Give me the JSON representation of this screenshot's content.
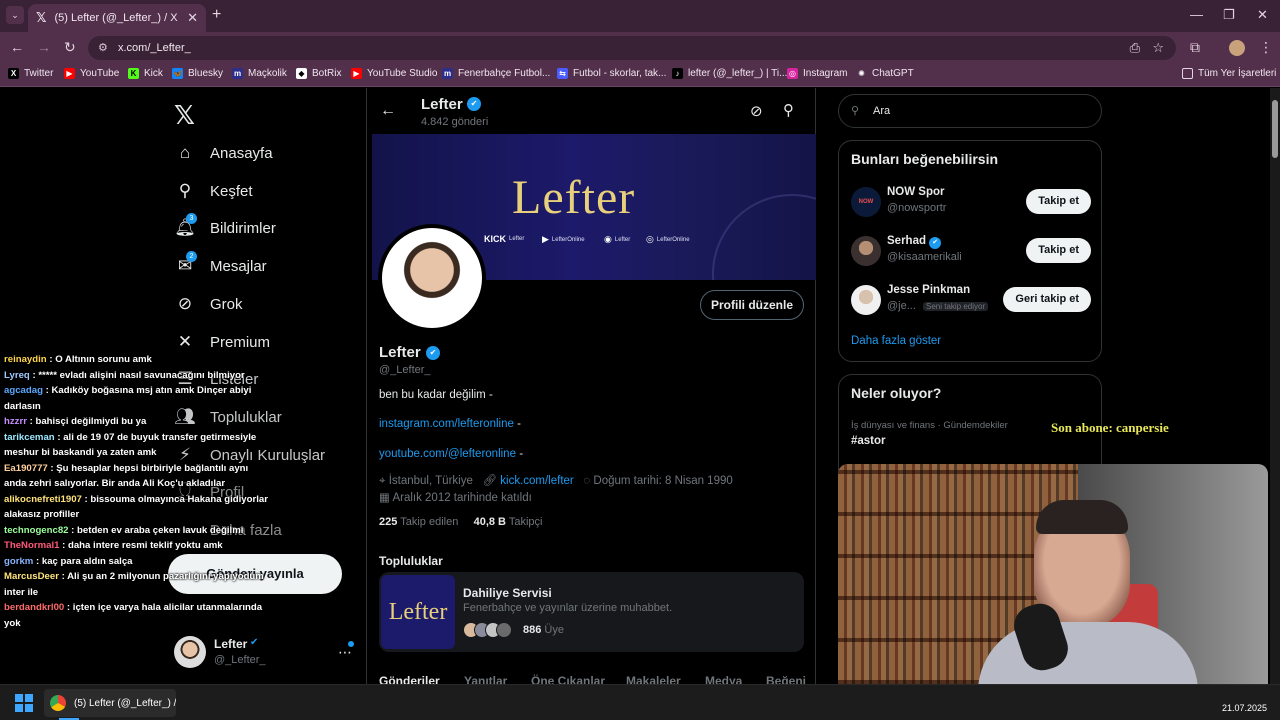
{
  "browser": {
    "tab_title": "(5) Lefter (@_Lefter_) / X",
    "url": "x.com/_Lefter_",
    "bookmarks": [
      "Twitter",
      "YouTube",
      "Kick",
      "Bluesky",
      "Maçkolik",
      "BotRix",
      "YouTube Studio",
      "Fenerbahçe Futbol...",
      "Futbol - skorlar, tak...",
      "lefter (@_lefter_) | Ti...",
      "Instagram",
      "ChatGPT"
    ],
    "all_bookmarks": "Tüm Yer İşaretleri"
  },
  "sidebar": {
    "items": [
      {
        "label": "Anasayfa",
        "icon": "home-icon"
      },
      {
        "label": "Keşfet",
        "icon": "search-icon"
      },
      {
        "label": "Bildirimler",
        "icon": "bell-icon",
        "badge": "3"
      },
      {
        "label": "Mesajlar",
        "icon": "mail-icon",
        "badge": "2"
      },
      {
        "label": "Grok",
        "icon": "grok-icon"
      },
      {
        "label": "Premium",
        "icon": "x-icon"
      },
      {
        "label": "Listeler",
        "icon": "list-icon"
      },
      {
        "label": "Topluluklar",
        "icon": "people-icon"
      },
      {
        "label": "Onaylı Kuruluşlar",
        "icon": "lightning-icon"
      },
      {
        "label": "Profil",
        "icon": "person-icon"
      },
      {
        "label": "Daha fazla",
        "icon": "more-icon"
      }
    ],
    "post_label": "Gönderi yayınla",
    "account_name": "Lefter",
    "account_handle": "@_Lefter_"
  },
  "chat": [
    {
      "user": "reinaydin",
      "color": "#ffd54a",
      "text": "O Altının sorunu amk"
    },
    {
      "user": "Lyreq",
      "color": "#9ecbff",
      "text": "***** evladı alişini nasıl savunacağını bilmiyor"
    },
    {
      "user": "agcadag",
      "color": "#5aa9ff",
      "text": "Kadıköy boğasına msj atın amk Dinçer abiyi darlasın"
    },
    {
      "user": "hzzrr",
      "color": "#c58cff",
      "text": "bahisçi değilmiydi bu ya"
    },
    {
      "user": "tarikceman",
      "color": "#9ee8ff",
      "text": "ali de 19 07 de buyuk transfer getirmesiyle meshur bi baskandi ya zaten amk"
    },
    {
      "user": "Ea190777",
      "color": "#ffd0a0",
      "text": "Şu hesaplar hepsi birbiriyle bağlantılı aynı anda zehri salıyorlar. Bir anda Ali Koç'u akladılar"
    },
    {
      "user": "alikocnefreti1907",
      "color": "#ffe27a",
      "text": "bissouma olmayınca Hakana gidiyorlar alakasız profiller"
    },
    {
      "user": "technogenc82",
      "color": "#9cff9c",
      "text": "betden ev araba çeken lavuk değilmi"
    },
    {
      "user": "TheNormal1",
      "color": "#ff5a7a",
      "text": "daha intere resmi teklif yoktu amk"
    },
    {
      "user": "gorkm",
      "color": "#8ab4ff",
      "text": "kaç para aldın salça"
    },
    {
      "user": "MarcusDeer",
      "color": "#ffe47a",
      "text": "Ali şu an 2 milyonun pazarlığını yapıyodum inter ile"
    },
    {
      "user": "berdandkrl00",
      "color": "#ff6b6b",
      "text": "içten içe varya hala alicilar utanmalarında yok"
    }
  ],
  "profile": {
    "name": "Lefter",
    "post_count": "4.842 gönderi",
    "handle": "@_Lefter_",
    "bio": "ben bu kadar değilim -",
    "link1": "instagram.com/lefteronline",
    "link2": "youtube.com/@lefteronline",
    "dash": "-",
    "location": "İstanbul, Türkiye",
    "website": "kick.com/lefter",
    "birthday": "Doğum tarihi: 8 Nisan 1990",
    "joined": "Aralık 2012 tarihinde katıldı",
    "following_count": "225",
    "following_label": "Takip edilen",
    "followers_count": "40,8 B",
    "followers_label": "Takipçi",
    "edit_label": "Profili düzenle",
    "banner_logo": "Lefter",
    "banner_social": [
      {
        "platform": "KICK",
        "name": "Lefter"
      },
      {
        "platform": "YouTube",
        "name": "LefterOnline"
      },
      {
        "platform": "Discord",
        "name": "Lefter"
      },
      {
        "platform": "Instagram",
        "name": "LefterOnline"
      }
    ]
  },
  "communities": {
    "title": "Topluluklar",
    "name": "Dahiliye Servisi",
    "desc": "Fenerbahçe ve yayınlar üzerine muhabbet.",
    "members": "886",
    "members_label": "Üye"
  },
  "tabs": [
    "Gönderiler",
    "Yanıtlar",
    "Öne Çıkanlar",
    "Makaleler",
    "Medya",
    "Beğeni"
  ],
  "right": {
    "search_placeholder": "Ara",
    "suggest_title": "Bunları beğenebilirsin",
    "suggestions": [
      {
        "name": "NOW Spor",
        "handle": "@nowsportr",
        "btn": "Takip et"
      },
      {
        "name": "Serhad",
        "handle": "@kisaamerikali",
        "btn": "Takip et"
      },
      {
        "name": "Jesse Pinkman",
        "handle": "@je...",
        "btn": "Geri takip et",
        "tag": "Seni takip ediyor"
      }
    ],
    "show_more": "Daha fazla göster",
    "trends_title": "Neler oluyor?",
    "trend_category": "İş dünyası ve finans · Gündemdekiler",
    "trend_name": "#astor"
  },
  "overlay": {
    "sub_label": "Son abone: canpersie"
  },
  "taskbar": {
    "window_title": "(5) Lefter (@_Lefter_) / X",
    "date": "21.07.2025"
  },
  "colors": {
    "accent": "#1d9bf0",
    "chrome": "#52304b",
    "overlay_yellow": "#e8e85a"
  }
}
